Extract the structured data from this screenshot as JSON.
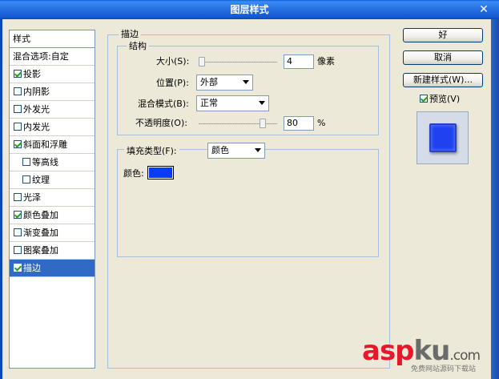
{
  "window": {
    "title": "图层样式",
    "close_glyph": "✕"
  },
  "style_list": {
    "header": "样式",
    "blend_options": "混合选项:自定",
    "items": [
      {
        "label": "投影",
        "checked": true,
        "indent": false,
        "selected": false
      },
      {
        "label": "内阴影",
        "checked": false,
        "indent": false,
        "selected": false
      },
      {
        "label": "外发光",
        "checked": false,
        "indent": false,
        "selected": false
      },
      {
        "label": "内发光",
        "checked": false,
        "indent": false,
        "selected": false
      },
      {
        "label": "斜面和浮雕",
        "checked": true,
        "indent": false,
        "selected": false
      },
      {
        "label": "等高线",
        "checked": false,
        "indent": true,
        "selected": false
      },
      {
        "label": "纹理",
        "checked": false,
        "indent": true,
        "selected": false
      },
      {
        "label": "光泽",
        "checked": false,
        "indent": false,
        "selected": false
      },
      {
        "label": "颜色叠加",
        "checked": true,
        "indent": false,
        "selected": false
      },
      {
        "label": "渐变叠加",
        "checked": false,
        "indent": false,
        "selected": false
      },
      {
        "label": "图案叠加",
        "checked": false,
        "indent": false,
        "selected": false
      },
      {
        "label": "描边",
        "checked": true,
        "indent": false,
        "selected": true
      }
    ]
  },
  "stroke": {
    "group_title": "描边",
    "structure_title": "结构",
    "size_label": "大小(S):",
    "size_value": "4",
    "size_unit": "像素",
    "position_label": "位置(P):",
    "position_value": "外部",
    "blend_mode_label": "混合模式(B):",
    "blend_mode_value": "正常",
    "opacity_label": "不透明度(O):",
    "opacity_value": "80",
    "opacity_unit": "%",
    "fill_type_label": "填充类型(F):",
    "fill_type_value": "颜色",
    "color_label": "颜色:",
    "color_value": "#0a3cf5"
  },
  "buttons": {
    "ok": "好",
    "cancel": "取消",
    "new_style": "新建样式(W)...",
    "preview": "预览(V)",
    "preview_checked": true
  },
  "watermark": {
    "asp": "asp",
    "ku": "ku",
    "com": ".com",
    "sub": "免费网站源码下载站"
  }
}
